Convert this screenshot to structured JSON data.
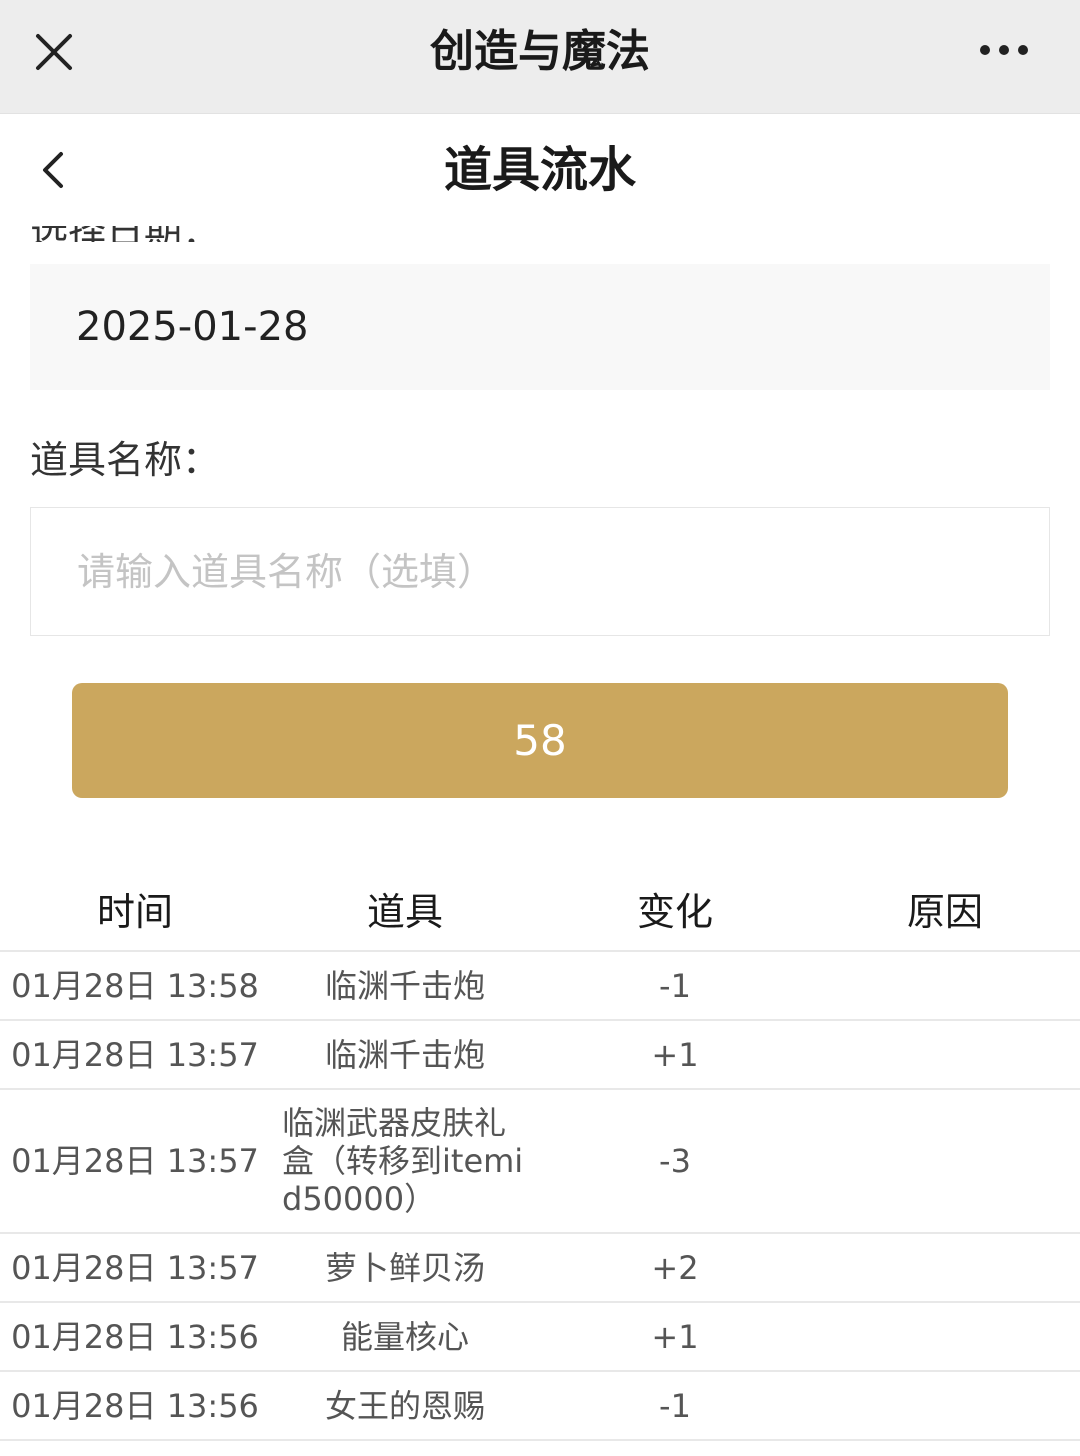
{
  "topbar": {
    "title": "创造与魔法",
    "close_icon": "close-icon",
    "more_icon": "more-horizontal-icon"
  },
  "page": {
    "title": "道具流水",
    "back_icon": "chevron-left-icon"
  },
  "form": {
    "date_label": "选择日期：",
    "date_value": "2025-01-28",
    "name_label": "道具名称：",
    "name_placeholder": "请输入道具名称（选填）",
    "name_value": "",
    "query_button_label": "58"
  },
  "table": {
    "headers": [
      "时间",
      "道具",
      "变化",
      "原因"
    ],
    "rows": [
      {
        "time": "01月28日 13:58",
        "item": "临渊千击炮",
        "change": "-1",
        "reason": ""
      },
      {
        "time": "01月28日 13:57",
        "item": "临渊千击炮",
        "change": "+1",
        "reason": ""
      },
      {
        "time": "01月28日 13:57",
        "item": "临渊武器皮肤礼盒（转移到itemid50000）",
        "change": "-3",
        "reason": ""
      },
      {
        "time": "01月28日 13:57",
        "item": "萝卜鲜贝汤",
        "change": "+2",
        "reason": ""
      },
      {
        "time": "01月28日 13:56",
        "item": "能量核心",
        "change": "+1",
        "reason": ""
      },
      {
        "time": "01月28日 13:56",
        "item": "女王的恩赐",
        "change": "-1",
        "reason": ""
      }
    ]
  },
  "colors": {
    "accent": "#cba75e",
    "topbar_bg": "#ededed",
    "field_bg": "#f8f8f8",
    "placeholder": "#c4c4c4"
  }
}
